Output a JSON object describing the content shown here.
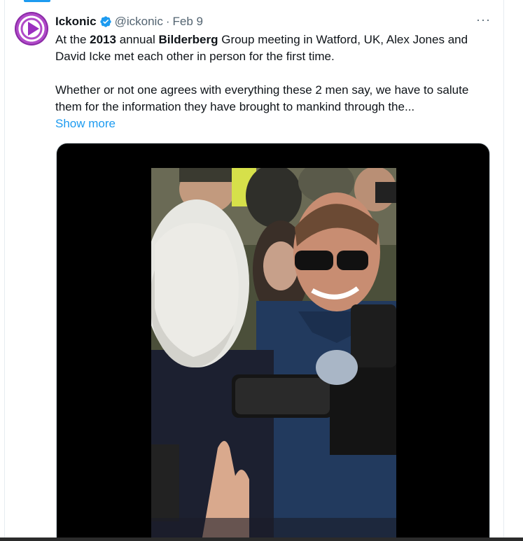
{
  "tweet": {
    "author": {
      "display_name": "Ickonic",
      "handle": "@ickonic",
      "verified": true,
      "avatar_icon": "play-logo-icon"
    },
    "separator": "·",
    "date": "Feb 9",
    "more_label": "···",
    "text": {
      "line1_pre": "At the ",
      "line1_bold1": "2013",
      "line1_mid": " annual ",
      "line1_bold2": "Bilderberg",
      "line1_post": " Group meeting in Watford, UK, Alex Jones and David Icke met each other in person for the first time.",
      "paragraph2": "Whether or not one agrees with everything these 2 men say, we have to salute them for the information they have brought to mankind through the...",
      "show_more": "Show more"
    },
    "media": {
      "type": "video",
      "description_icon": "video-thumbnail"
    }
  },
  "colors": {
    "link": "#1d9bf0",
    "text": "#0f1419",
    "muted": "#536471",
    "brand": "#8a2aa6"
  }
}
